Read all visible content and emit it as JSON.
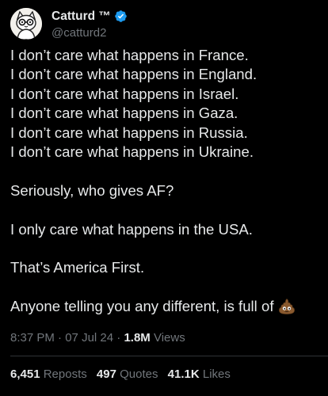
{
  "author": {
    "display_name": "Catturd ™",
    "handle": "@catturd2",
    "verified_color": "#1d9bf0"
  },
  "tweet": {
    "lines": [
      "I don’t care what happens in France.",
      "I don’t care what happens in England.",
      "I don’t care what happens in Israel.",
      "I don’t care what happens in Gaza.",
      "I don’t care what happens in Russia.",
      "I don’t care what happens in Ukraine."
    ],
    "para2": "Seriously, who gives AF?",
    "para3": "I only care what happens in the USA.",
    "para4": "That’s America First.",
    "para5": "Anyone telling you any different, is full of",
    "trailing_emoji": "pile-of-poo-icon"
  },
  "meta": {
    "time": "8:37 PM",
    "date": "07 Jul 24",
    "views_count": "1.8M",
    "views_label": "Views"
  },
  "stats": {
    "reposts_count": "6,451",
    "reposts_label": "Reposts",
    "quotes_count": "497",
    "quotes_label": "Quotes",
    "likes_count": "41.1K",
    "likes_label": "Likes"
  }
}
